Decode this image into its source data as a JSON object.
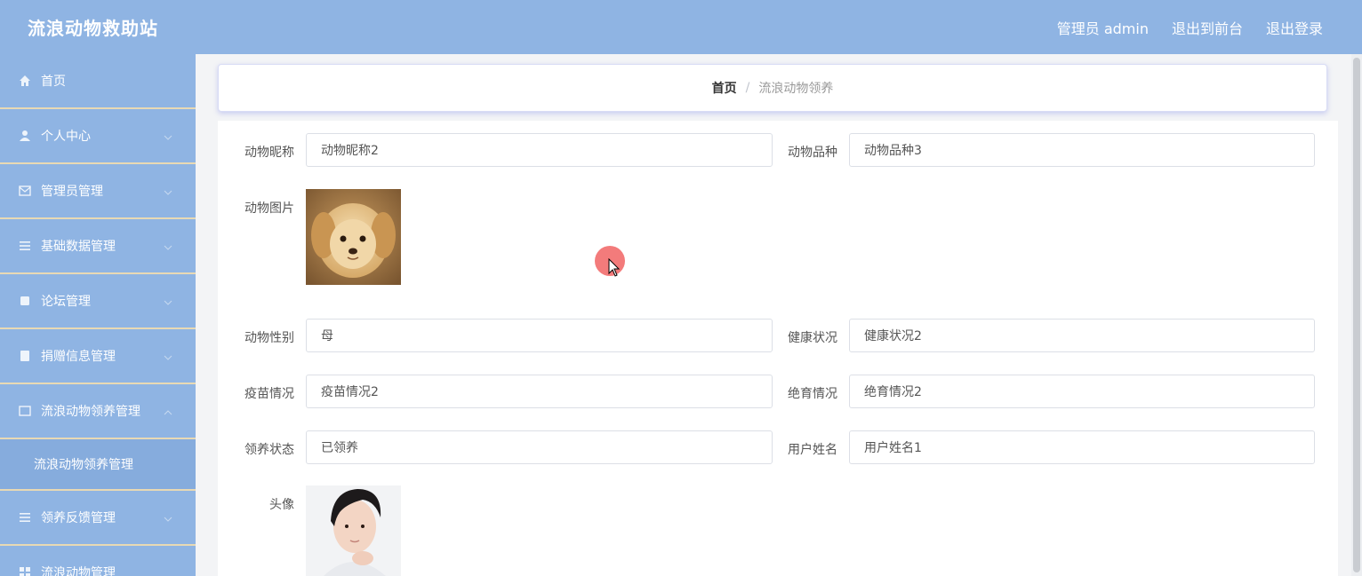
{
  "app": {
    "title": "流浪动物救助站",
    "admin_label": "管理员 admin",
    "to_front_label": "退出到前台",
    "logout_label": "退出登录"
  },
  "sidebar": {
    "items": [
      {
        "label": "首页",
        "icon": "home-icon"
      },
      {
        "label": "个人中心",
        "icon": "user-icon"
      },
      {
        "label": "管理员管理",
        "icon": "mail-icon"
      },
      {
        "label": "基础数据管理",
        "icon": "menu-icon"
      },
      {
        "label": "论坛管理",
        "icon": "forum-icon"
      },
      {
        "label": "捐赠信息管理",
        "icon": "document-icon"
      },
      {
        "label": "流浪动物领养管理",
        "icon": "list-icon"
      },
      {
        "label": "流浪动物领养管理"
      },
      {
        "label": "领养反馈管理",
        "icon": "menu-icon"
      },
      {
        "label": "流浪动物管理",
        "icon": "grid-icon"
      }
    ]
  },
  "breadcrumb": {
    "home": "首页",
    "separator": "/",
    "current": "流浪动物领养"
  },
  "form": {
    "nickname": {
      "label": "动物昵称",
      "value": "动物昵称2"
    },
    "breed": {
      "label": "动物品种",
      "value": "动物品种3"
    },
    "photo": {
      "label": "动物图片"
    },
    "gender": {
      "label": "动物性别",
      "value": "母"
    },
    "health": {
      "label": "健康状况",
      "value": "健康状况2"
    },
    "vaccine": {
      "label": "疫苗情况",
      "value": "疫苗情况2"
    },
    "sterilization": {
      "label": "绝育情况",
      "value": "绝育情况2"
    },
    "adopt_status": {
      "label": "领养状态",
      "value": "已领养"
    },
    "username": {
      "label": "用户姓名",
      "value": "用户姓名1"
    },
    "avatar": {
      "label": "头像"
    }
  },
  "colors": {
    "header_bg": "#8fb4e3",
    "sidebar_bg": "#8fb4e3",
    "sidebar_divider": "#e8d9b4",
    "card_border": "#d8dcf5"
  }
}
